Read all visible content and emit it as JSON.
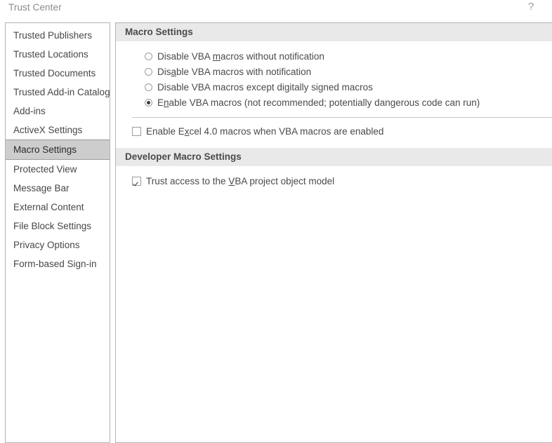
{
  "dialog": {
    "title": "Trust Center",
    "help_icon": "help-question-icon",
    "help_glyph": "?"
  },
  "sidebar": {
    "items": [
      {
        "label": "Trusted Publishers",
        "selected": false
      },
      {
        "label": "Trusted Locations",
        "selected": false
      },
      {
        "label": "Trusted Documents",
        "selected": false
      },
      {
        "label": "Trusted Add-in Catalogs",
        "selected": false
      },
      {
        "label": "Add-ins",
        "selected": false
      },
      {
        "label": "ActiveX Settings",
        "selected": false
      },
      {
        "label": "Macro Settings",
        "selected": true
      },
      {
        "label": "Protected View",
        "selected": false
      },
      {
        "label": "Message Bar",
        "selected": false
      },
      {
        "label": "External Content",
        "selected": false
      },
      {
        "label": "File Block Settings",
        "selected": false
      },
      {
        "label": "Privacy Options",
        "selected": false
      },
      {
        "label": "Form-based Sign-in",
        "selected": false
      }
    ]
  },
  "main": {
    "macro_settings": {
      "header": "Macro Settings",
      "radio_group_name": "macro-setting",
      "options": [
        {
          "label": "Disable VBA macros without notification",
          "accel_pre": "Disable VBA ",
          "accel_char": "m",
          "accel_post": "acros without notification",
          "checked": false
        },
        {
          "label": "Disable VBA macros with notification",
          "accel_pre": "Dis",
          "accel_char": "a",
          "accel_post": "ble VBA macros with notification",
          "checked": false
        },
        {
          "label": "Disable VBA macros except digitally signed macros",
          "accel_pre": "Disable VBA macros except di",
          "accel_char": "g",
          "accel_post": "itally signed macros",
          "checked": false
        },
        {
          "label": "Enable VBA macros (not recommended; potentially dangerous code can run)",
          "accel_pre": "E",
          "accel_char": "n",
          "accel_post": "able VBA macros (not recommended; potentially dangerous code can run)",
          "checked": true
        }
      ],
      "excel4_checkbox": {
        "label": "Enable Excel 4.0 macros when VBA macros are enabled",
        "accel_pre": "Enable E",
        "accel_char": "x",
        "accel_post": "cel 4.0 macros when VBA macros are enabled",
        "checked": false
      }
    },
    "developer_macro_settings": {
      "header": "Developer Macro Settings",
      "trust_vba_checkbox": {
        "label": "Trust access to the VBA project object model",
        "accel_pre": "Trust access to the ",
        "accel_char": "V",
        "accel_post": "BA project object model",
        "checked": true
      }
    }
  },
  "colors": {
    "panel_border": "#b4b4b4",
    "section_header_bg": "#e9e9e9",
    "selected_item_bg": "#cdcdcd",
    "text": "#4a4a4a",
    "title_text": "#8a8a8a"
  }
}
